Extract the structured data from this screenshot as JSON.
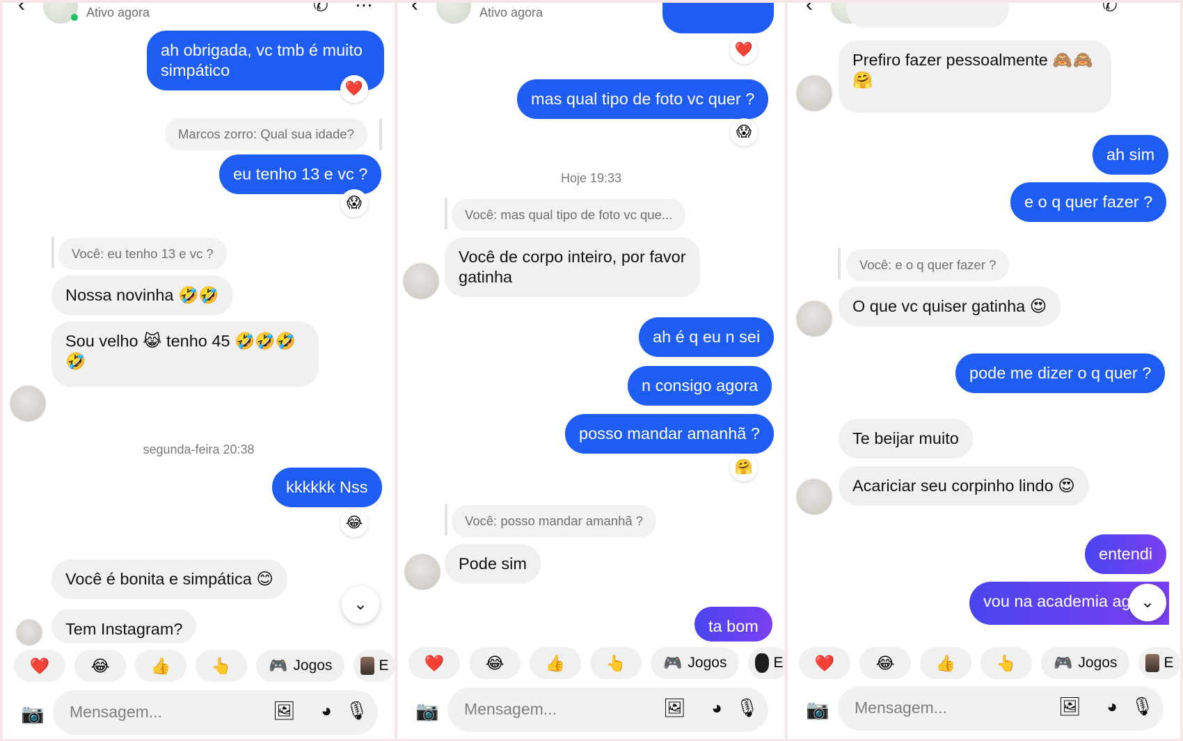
{
  "header": {
    "status": "Ativo agora"
  },
  "reactions": {
    "heart": "❤️",
    "scream": "😱",
    "laugh": "😂",
    "blush": "🤗"
  },
  "quick_reactions": [
    "❤️",
    "😂",
    "👍",
    "👆"
  ],
  "games_label": "Jogos",
  "games_partial": "E",
  "composer": {
    "placeholder": "Mensagem..."
  },
  "panel1": {
    "messages": [
      {
        "text": "ah obrigada, vc tmb é muito\nsimpático"
      },
      {
        "text": "Marcos zorro: Qual sua idade?"
      },
      {
        "text": "eu tenho 13 e vc ?"
      },
      {
        "text": "Você: eu tenho 13 e vc ?"
      },
      {
        "text": "Nossa novinha 🤣🤣"
      },
      {
        "text": "Sou velho 😹 tenho 45 🤣🤣🤣\n🤣"
      },
      {
        "text": "segunda-feira 20:38"
      },
      {
        "text": "kkkkkk Nss"
      },
      {
        "text": "Você é bonita e simpática 😊"
      },
      {
        "text": "Tem Instagram?"
      }
    ]
  },
  "panel2": {
    "messages": [
      {
        "text": "mas qual tipo de foto vc quer ?"
      },
      {
        "text": "Hoje 19:33"
      },
      {
        "text": "Você: mas qual tipo de foto vc que..."
      },
      {
        "text": "Você de corpo inteiro, por favor\ngatinha"
      },
      {
        "text": "ah é q eu n sei"
      },
      {
        "text": "n consigo agora"
      },
      {
        "text": "posso mandar amanhã ?"
      },
      {
        "text": "Você: posso mandar amanhã ?"
      },
      {
        "text": "Pode sim"
      },
      {
        "text": "ta bom"
      }
    ]
  },
  "panel3": {
    "messages": [
      {
        "text": "Prefiro fazer pessoalmente 🙈🙈\n🤗"
      },
      {
        "text": "ah sim"
      },
      {
        "text": "e o q quer fazer ?"
      },
      {
        "text": "Você: e o q quer fazer ?"
      },
      {
        "text": "O que vc quiser gatinha 😍"
      },
      {
        "text": "pode me dizer o q quer ?"
      },
      {
        "text": "Te beijar muito"
      },
      {
        "text": "Acariciar seu corpinho lindo 😍"
      },
      {
        "text": "entendi"
      },
      {
        "text": "vou na academia ag"
      }
    ]
  }
}
